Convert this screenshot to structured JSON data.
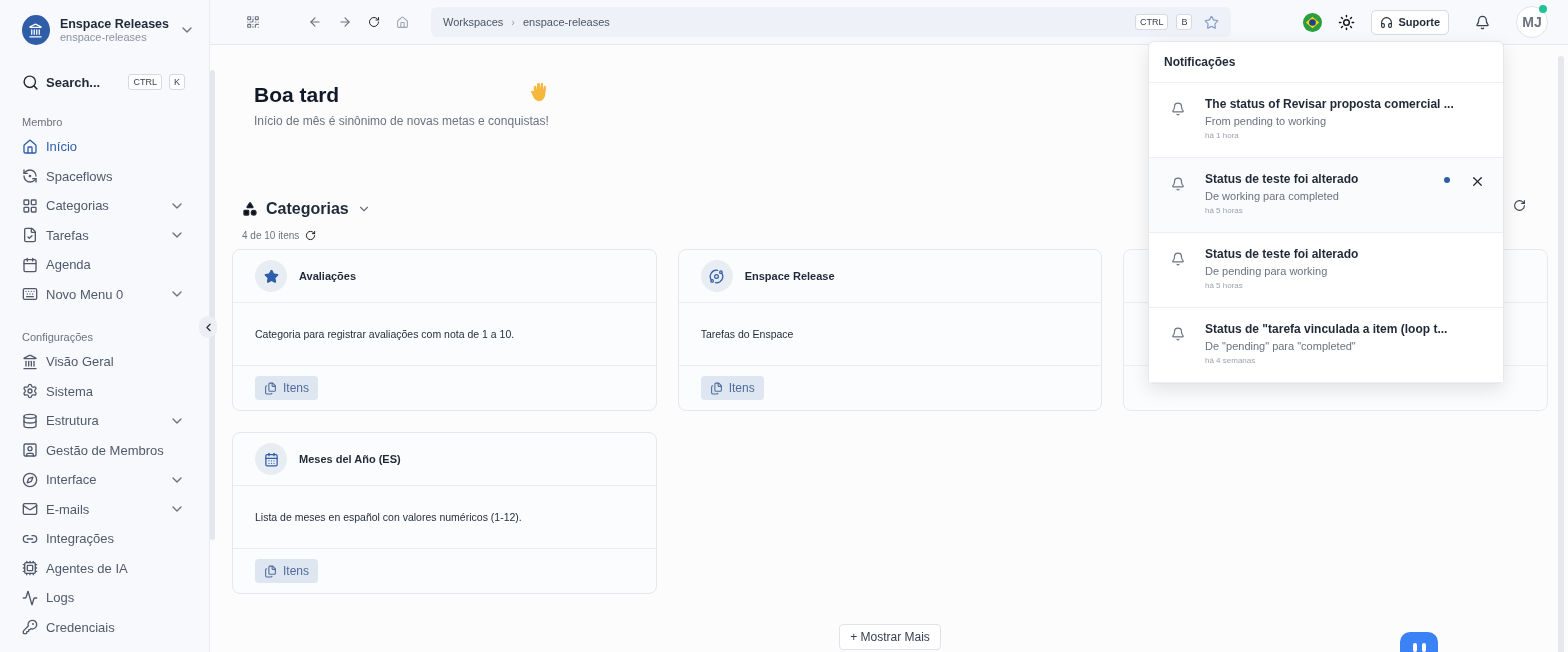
{
  "workspace": {
    "name": "Enspace Releases",
    "slug": "enspace-releases"
  },
  "search": {
    "placeholder": "Search...",
    "keys": [
      "CTRL",
      "K"
    ]
  },
  "sidebar": {
    "sections": [
      {
        "label": "Membro",
        "items": [
          {
            "label": "Início",
            "selected": true,
            "has_submenu": false
          },
          {
            "label": "Spaceflows",
            "selected": false,
            "has_submenu": false
          },
          {
            "label": "Categorias",
            "selected": false,
            "has_submenu": true
          },
          {
            "label": "Tarefas",
            "selected": false,
            "has_submenu": true
          },
          {
            "label": "Agenda",
            "selected": false,
            "has_submenu": false
          },
          {
            "label": "Novo Menu 0",
            "selected": false,
            "has_submenu": true
          }
        ]
      },
      {
        "label": "Configurações",
        "items": [
          {
            "label": "Visão Geral",
            "selected": false,
            "has_submenu": false
          },
          {
            "label": "Sistema",
            "selected": false,
            "has_submenu": false
          },
          {
            "label": "Estrutura",
            "selected": false,
            "has_submenu": true
          },
          {
            "label": "Gestão de Membros",
            "selected": false,
            "has_submenu": false
          },
          {
            "label": "Interface",
            "selected": false,
            "has_submenu": true
          },
          {
            "label": "E-mails",
            "selected": false,
            "has_submenu": true
          },
          {
            "label": "Integrações",
            "selected": false,
            "has_submenu": false
          },
          {
            "label": "Agentes de IA",
            "selected": false,
            "has_submenu": false
          },
          {
            "label": "Logs",
            "selected": false,
            "has_submenu": false
          },
          {
            "label": "Credenciais",
            "selected": false,
            "has_submenu": false
          }
        ]
      }
    ]
  },
  "topbar": {
    "breadcrumb": [
      "Workspaces",
      "enspace-releases"
    ],
    "separator": "›",
    "shortcut": [
      "CTRL",
      "B"
    ],
    "support_button": "Suporte",
    "avatar": "MJ",
    "online": true
  },
  "greeting": {
    "title": "Boa tard",
    "subtitle": "Início de mês é sinônimo de novas metas e conquistas!"
  },
  "categories": {
    "title": "Categorias",
    "count": "4 de 10 itens",
    "show_more": "+ Mostrar Mais",
    "cards": [
      {
        "title": "Avaliações",
        "description": "Categoria para registrar avaliações com nota de 1 a 10.",
        "button": "Itens"
      },
      {
        "title": "Enspace Release",
        "description": "Tarefas do Enspace",
        "button": "Itens"
      },
      {
        "covered": true
      },
      {
        "title": "Meses del Año (ES)",
        "description": "Lista de meses en español con valores numéricos (1-12).",
        "button": "Itens"
      }
    ]
  },
  "notifications": {
    "title": "Notificações",
    "items": [
      {
        "title": "The status of Revisar proposta comercial ...",
        "detail": "From pending to working",
        "time": "há 1 hora",
        "unread": false,
        "hovered": false
      },
      {
        "title": "Status de teste foi alterado",
        "detail": "De working para completed",
        "time": "há 5 horas",
        "unread": true,
        "hovered": true
      },
      {
        "title": "Status de teste foi alterado",
        "detail": "De pending para working",
        "time": "há 5 horas",
        "unread": false,
        "hovered": false
      },
      {
        "title": "Status de \"tarefa vinculada a item (loop t...",
        "detail": "De \"pending\" para \"completed\"",
        "time": "há 4 semanas",
        "unread": false,
        "hovered": false
      }
    ]
  }
}
